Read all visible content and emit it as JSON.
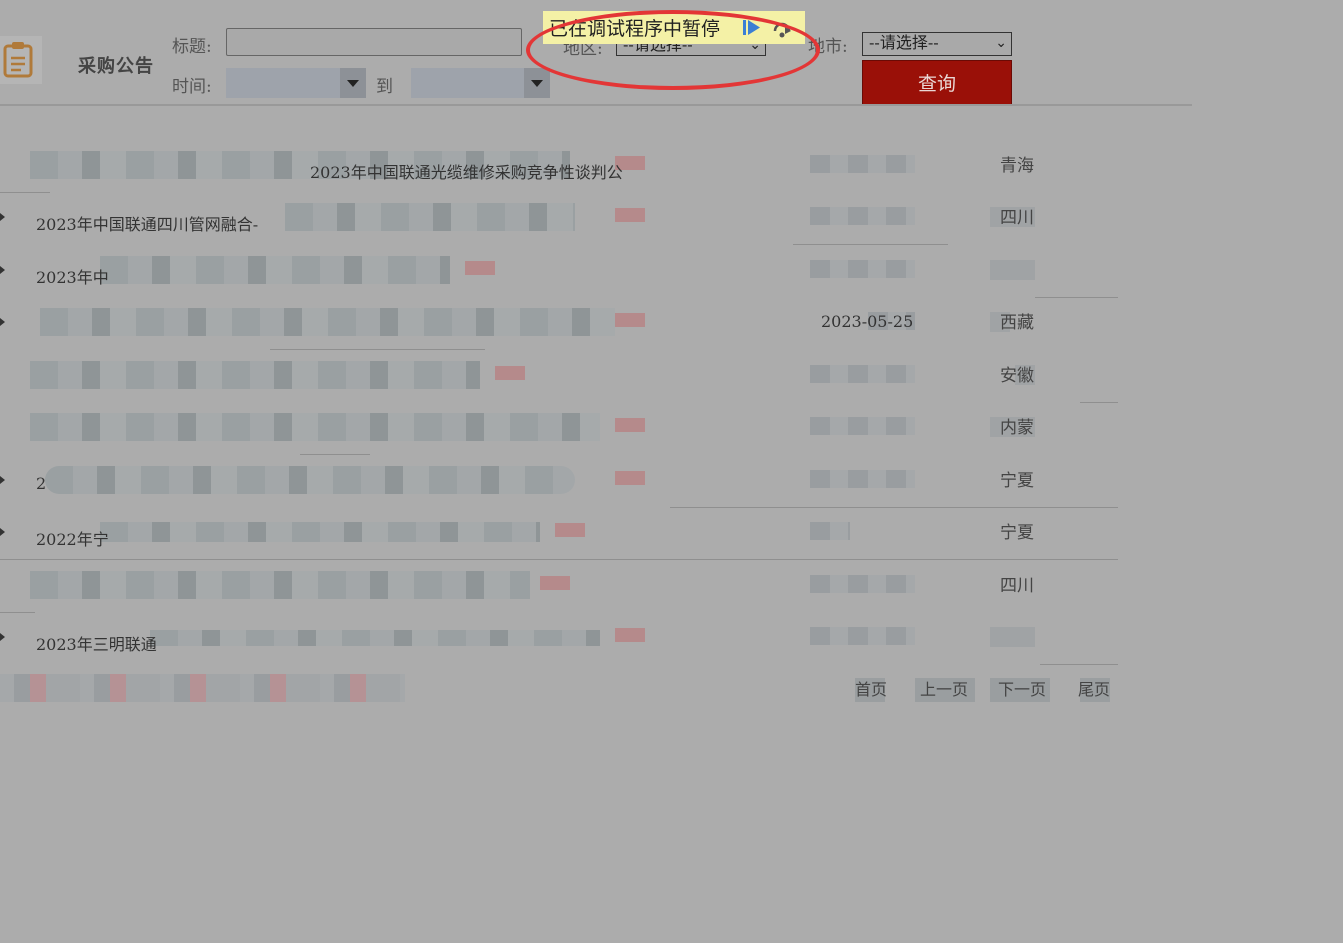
{
  "header": {
    "section_title": "采购公告",
    "title_label": "标题:",
    "title_value": "",
    "time_label": "时间:",
    "to_label": "到",
    "region_label": "地区:",
    "region_value": "--请选择--",
    "city_label": "地市:",
    "city_value": "--请选择--",
    "query_button": "查询"
  },
  "debug_bar": {
    "text": "已在调试程序中暂停"
  },
  "rows": [
    {
      "title": "2023年中国联通光缆维修采购竞争性谈判公",
      "date": "",
      "region": "青海"
    },
    {
      "title": "2023年中国联通四川管网融合-",
      "date": "",
      "region": "四川"
    },
    {
      "title": "2023年中",
      "date": "",
      "region": ""
    },
    {
      "title": "",
      "date": "2023-05-25",
      "region": "西藏"
    },
    {
      "title": "",
      "date": "",
      "region": "安徽"
    },
    {
      "title": "",
      "date": "",
      "region": "内蒙"
    },
    {
      "title": "2",
      "date": "",
      "region": "宁夏"
    },
    {
      "title": "2022年宁",
      "date": "",
      "region": "宁夏"
    },
    {
      "title": "",
      "date": "",
      "region": "四川"
    },
    {
      "title": "2023年三明联通",
      "date": "",
      "region": ""
    }
  ],
  "pager": {
    "first": "首页",
    "prev": "上一页",
    "next": "下一页",
    "last": "尾页"
  },
  "colors": {
    "accent": "#9a1008",
    "debug_bg": "#f4f1a6",
    "highlight_circle": "#e33636"
  },
  "icons": [
    "clipboard-icon",
    "resume-icon",
    "step-over-icon",
    "chevron-down-icon",
    "row-arrow-icon"
  ]
}
